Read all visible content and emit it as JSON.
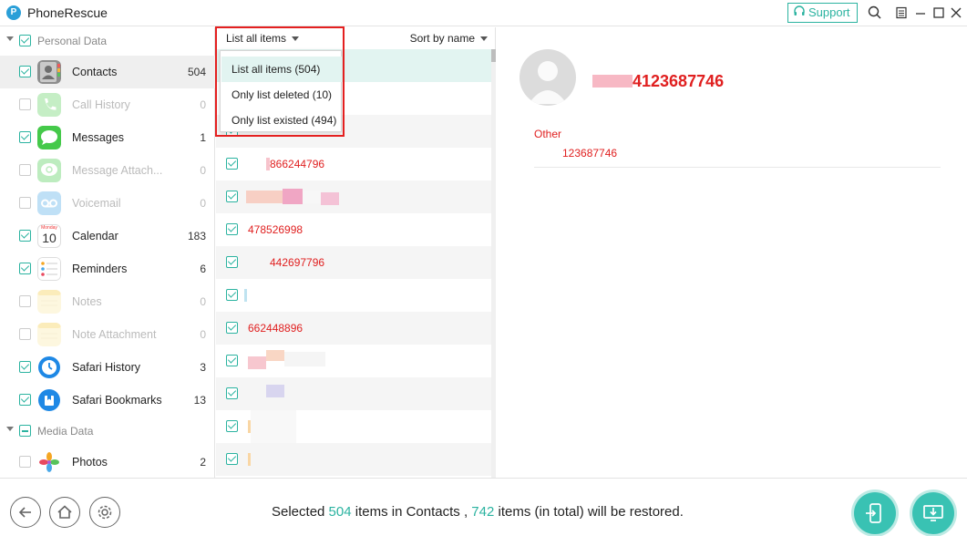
{
  "app": {
    "title": "PhoneRescue",
    "support_label": "Support"
  },
  "sidebar": {
    "groups": [
      {
        "label": "Personal Data"
      },
      {
        "label": "Media Data"
      }
    ],
    "items": [
      {
        "label": "Contacts",
        "count": "504",
        "checked": true,
        "enabled": true,
        "icon": "contacts-icon"
      },
      {
        "label": "Call History",
        "count": "0",
        "checked": false,
        "enabled": false,
        "icon": "phone-icon"
      },
      {
        "label": "Messages",
        "count": "1",
        "checked": true,
        "enabled": true,
        "icon": "messages-icon"
      },
      {
        "label": "Message Attach...",
        "count": "0",
        "checked": false,
        "enabled": false,
        "icon": "message-attachment-icon"
      },
      {
        "label": "Voicemail",
        "count": "0",
        "checked": false,
        "enabled": false,
        "icon": "voicemail-icon"
      },
      {
        "label": "Calendar",
        "count": "183",
        "checked": true,
        "enabled": true,
        "icon": "calendar-icon",
        "calendar_month": "Monday",
        "calendar_day": "10"
      },
      {
        "label": "Reminders",
        "count": "6",
        "checked": true,
        "enabled": true,
        "icon": "reminders-icon"
      },
      {
        "label": "Notes",
        "count": "0",
        "checked": false,
        "enabled": false,
        "icon": "notes-icon"
      },
      {
        "label": "Note Attachment",
        "count": "0",
        "checked": false,
        "enabled": false,
        "icon": "note-attachment-icon"
      },
      {
        "label": "Safari History",
        "count": "3",
        "checked": true,
        "enabled": true,
        "icon": "safari-history-icon"
      },
      {
        "label": "Safari Bookmarks",
        "count": "13",
        "checked": true,
        "enabled": true,
        "icon": "safari-bookmarks-icon"
      },
      {
        "label": "Photos",
        "count": "2",
        "checked": false,
        "enabled": true,
        "icon": "photos-icon"
      }
    ]
  },
  "list": {
    "filter_label": "List all items",
    "sort_label": "Sort by name",
    "rows": [
      {
        "text": ""
      },
      {
        "text": ""
      },
      {
        "text": ""
      },
      {
        "text": "866244796"
      },
      {
        "text": ""
      },
      {
        "text": "478526998"
      },
      {
        "text": "442697796"
      },
      {
        "text": ""
      },
      {
        "text": "662448896"
      },
      {
        "text": ""
      },
      {
        "text": ""
      },
      {
        "text": ""
      },
      {
        "text": ""
      }
    ]
  },
  "dropdown": {
    "options": [
      "List all items (504)",
      "Only list deleted (10)",
      "Only list existed (494)"
    ]
  },
  "detail": {
    "name": "4123687746",
    "field_label": "Other",
    "field_value": "123687746"
  },
  "footer": {
    "status_prefix": "Selected ",
    "selected_count": "504",
    "status_mid": " items in Contacts , ",
    "total_count": "742",
    "status_suffix": " items (in total) will be restored."
  },
  "colors": {
    "accent": "#2bb3a0",
    "highlight_red": "#e42020",
    "deleted_text": "#e02020"
  }
}
